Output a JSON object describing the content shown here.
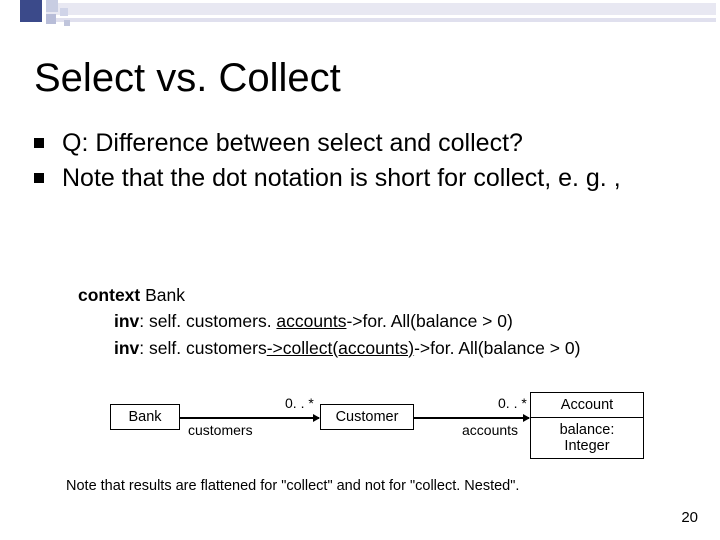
{
  "title": "Select vs. Collect",
  "bullets": [
    "Q: Difference between select and collect?",
    "Note that the dot notation is short for collect, e. g. ,"
  ],
  "code": {
    "kw_context": "context",
    "ctx_name": "Bank",
    "kw_inv": "inv",
    "line1_pre": ": self. customers. ",
    "line1_u": "accounts",
    "line1_post": "->for. All(balance > 0)",
    "line2_pre": ": self. customers",
    "line2_u": "->collect(accounts)",
    "line2_post": "->for. All(balance > 0)"
  },
  "uml": {
    "bank": "Bank",
    "customer": "Customer",
    "account": "Account",
    "account_attr": "balance: Integer",
    "mult": "0. . *",
    "role_customers": "customers",
    "role_accounts": "accounts"
  },
  "footnote": "Note that results are flattened for \"collect\" and not for \"collect. Nested\".",
  "page": "20"
}
